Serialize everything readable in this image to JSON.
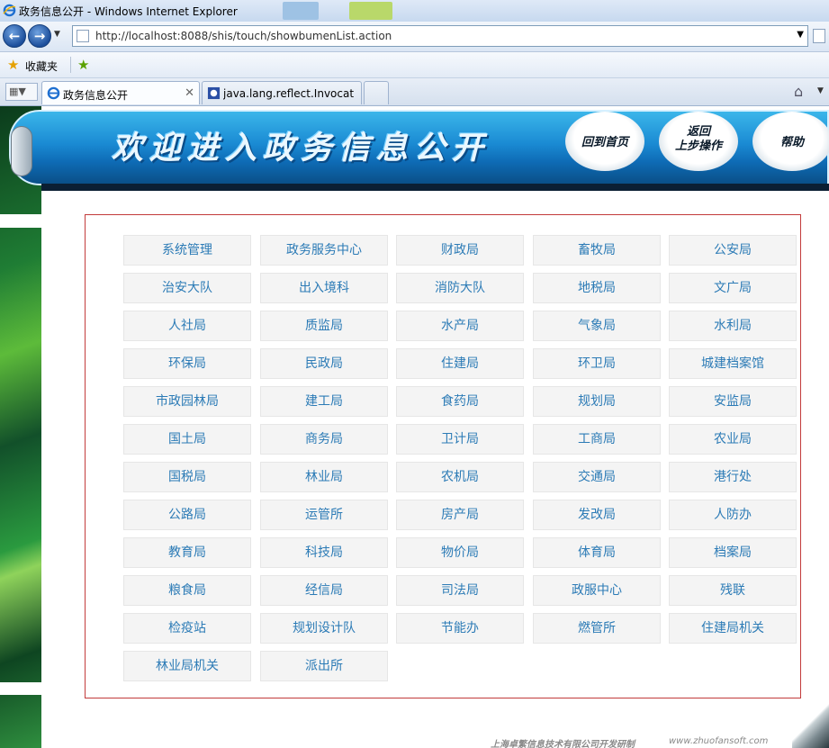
{
  "window": {
    "title": "政务信息公开 - Windows Internet Explorer"
  },
  "address_bar": {
    "url": "http://localhost:8088/shis/touch/showbumenList.action"
  },
  "favorites_bar": {
    "favorites_label": "收藏夹"
  },
  "tabs": [
    {
      "label": "政务信息公开",
      "active": true
    },
    {
      "label": "java.lang.reflect.Invocati...",
      "active": false
    }
  ],
  "banner": {
    "title": "欢迎进入政务信息公开",
    "home_button": "回到首页",
    "back_button_line1": "返回",
    "back_button_line2": "上步操作",
    "help_button": "帮助"
  },
  "departments": [
    "系统管理",
    "政务服务中心",
    "财政局",
    "畜牧局",
    "公安局",
    "治安大队",
    "出入境科",
    "消防大队",
    "地税局",
    "文广局",
    "人社局",
    "质监局",
    "水产局",
    "气象局",
    "水利局",
    "环保局",
    "民政局",
    "住建局",
    "环卫局",
    "城建档案馆",
    "市政园林局",
    "建工局",
    "食药局",
    "规划局",
    "安监局",
    "国土局",
    "商务局",
    "卫计局",
    "工商局",
    "农业局",
    "国税局",
    "林业局",
    "农机局",
    "交通局",
    "港行处",
    "公路局",
    "运管所",
    "房产局",
    "发改局",
    "人防办",
    "教育局",
    "科技局",
    "物价局",
    "体育局",
    "档案局",
    "粮食局",
    "经信局",
    "司法局",
    "政服中心",
    "残联",
    "检疫站",
    "规划设计队",
    "节能办",
    "燃管所",
    "住建局机关",
    "林业局机关",
    "派出所"
  ],
  "footer": {
    "company": "上海卓繁信息技术有限公司开发研制",
    "website": "www.zhuofansoft.com"
  }
}
